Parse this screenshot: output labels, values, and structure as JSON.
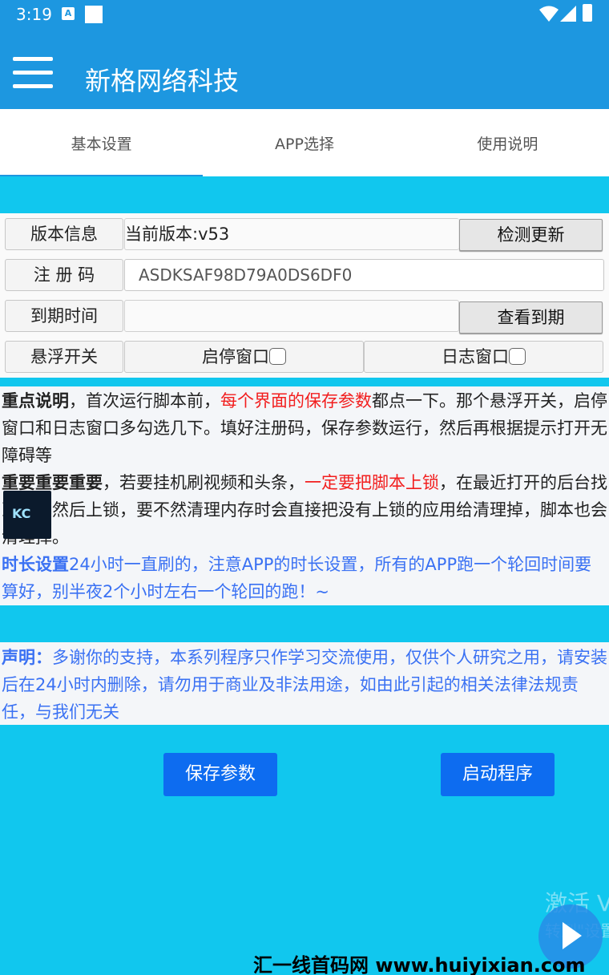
{
  "status_bar": {
    "time": "3:19",
    "a_badge": "A"
  },
  "app_bar": {
    "title": "新格网络科技"
  },
  "tabs": [
    {
      "label": "基本设置",
      "active": true
    },
    {
      "label": "APP选择",
      "active": false
    },
    {
      "label": "使用说明",
      "active": false
    }
  ],
  "form": {
    "version": {
      "label": "版本信息",
      "value": "当前版本:v53",
      "button": "检测更新"
    },
    "regcode": {
      "label": "注 册 码",
      "value": "ASDKSAF98D79A0DS6DF0"
    },
    "expiry": {
      "label": "到期时间",
      "value": "",
      "button": "查看到期"
    },
    "float": {
      "label": "悬浮开关",
      "opt1": "启停窗口",
      "opt2": "日志窗口"
    }
  },
  "notes": {
    "p1_bold": "重点说明",
    "p1_a": "，首次运行脚本前，",
    "p1_red": "每个界面的保存参数",
    "p1_b": "都点一下。那个悬浮开关，启停窗口和日志窗口多勾选几下。填好注册码，保存参数运行，然后再根据提示打开无障碍等",
    "p2_bold": "重要重要重要",
    "p2_a": "，若要挂机刷视频和头条，",
    "p2_red": "一定要把脚本上锁",
    "p2_b": "，在最近打开的",
    "p2_c": "找到脚本然后上锁，要不然清理内存时会直接把没有上锁的应用给清",
    "p2_d": "，脚本也会清理掉。",
    "p2_hidden1": "后台",
    "p2_hidden2": "理掉",
    "p3_bold": "时长设置",
    "p3_a": "24小时一直刷的，注意APP的时长设置，所有的APP跑一个轮回时间要算好，别半夜2个小时左右一个轮回的跑！~"
  },
  "statement": {
    "bold": "声明：",
    "text": "多谢你的支持，本系列程序只作学习交流使用，仅供个人研究之用，请安装后在24小时内删除，请勿用于商业及非法用途，如由此引起的相关法律法规责任，与我们无关"
  },
  "buttons": {
    "save": "保存参数",
    "start": "启动程序"
  },
  "watermark": {
    "line1": "激活 V",
    "line2": "转到\"设置",
    "footer": "汇一线首码网 www.huiyixian.com"
  },
  "colors": {
    "primary": "#1d97e0",
    "background": "#11c7ee",
    "button": "#0d6cf0",
    "red_text": "#f21e1e",
    "blue_text": "#3a71f3"
  }
}
